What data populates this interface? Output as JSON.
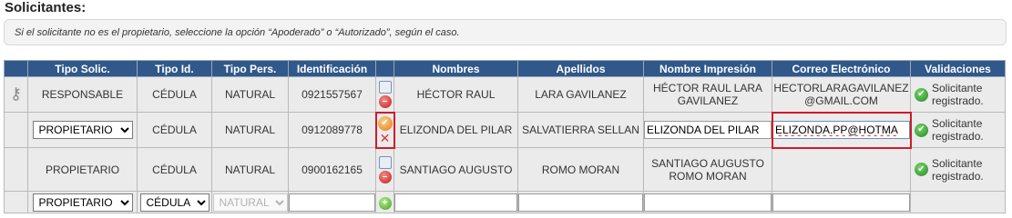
{
  "section_title": "Solicitantes:",
  "notice_text": "Si el solicitante no es el propietario, seleccione la opción “Apoderado” o “Autorizado”, según el caso.",
  "headers": [
    "Tipo Solic.",
    "Tipo Id.",
    "Tipo Pers.",
    "Identificación",
    "Nombres",
    "Apellidos",
    "Nombre Impresión",
    "Correo Electrónico",
    "Validaciones"
  ],
  "rows": [
    {
      "tipo_solic": "RESPONSABLE",
      "tipo_id": "CÉDULA",
      "tipo_pers": "NATURAL",
      "identificacion": "0921557567",
      "nombres": "HÉCTOR RAUL",
      "apellidos": "LARA GAVILANEZ",
      "nombre_impresion": "HÉCTOR RAUL LARA GAVILANEZ",
      "correo": "HECTORLARAGAVILANEZ@GMAIL.COM",
      "validacion": "Solicitante registrado."
    },
    {
      "tipo_solic": "PROPIETARIO",
      "tipo_id": "CÉDULA",
      "tipo_pers": "NATURAL",
      "identificacion": "0912089778",
      "nombres": "ELIZONDA DEL PILAR",
      "apellidos": "SALVATIERRA SELLAN",
      "nombre_impresion": "ELIZONDA DEL PILAR",
      "correo": "ELIZONDA.PP@HOTMA",
      "validacion": "Solicitante registrado."
    },
    {
      "tipo_solic": "PROPIETARIO",
      "tipo_id": "CÉDULA",
      "tipo_pers": "NATURAL",
      "identificacion": "0900162165",
      "nombres": "SANTIAGO AUGUSTO",
      "apellidos": "ROMO MORAN",
      "nombre_impresion": "SANTIAGO AUGUSTO ROMO MORAN",
      "correo": "",
      "validacion": "Solicitante registrado."
    }
  ],
  "new_row": {
    "tipo_solic": "PROPIETARIO",
    "tipo_id": "CÉDULA",
    "tipo_pers": "NATURAL"
  },
  "icons": {
    "key": "key-icon",
    "edit": "edit-document-icon",
    "delete": "remove-icon",
    "confirm": "confirm-icon",
    "cancel": "cancel-x-icon",
    "add": "add-icon",
    "check": "check-icon"
  },
  "colors": {
    "header_bg": "#30588a",
    "highlight": "#d11a2a"
  }
}
